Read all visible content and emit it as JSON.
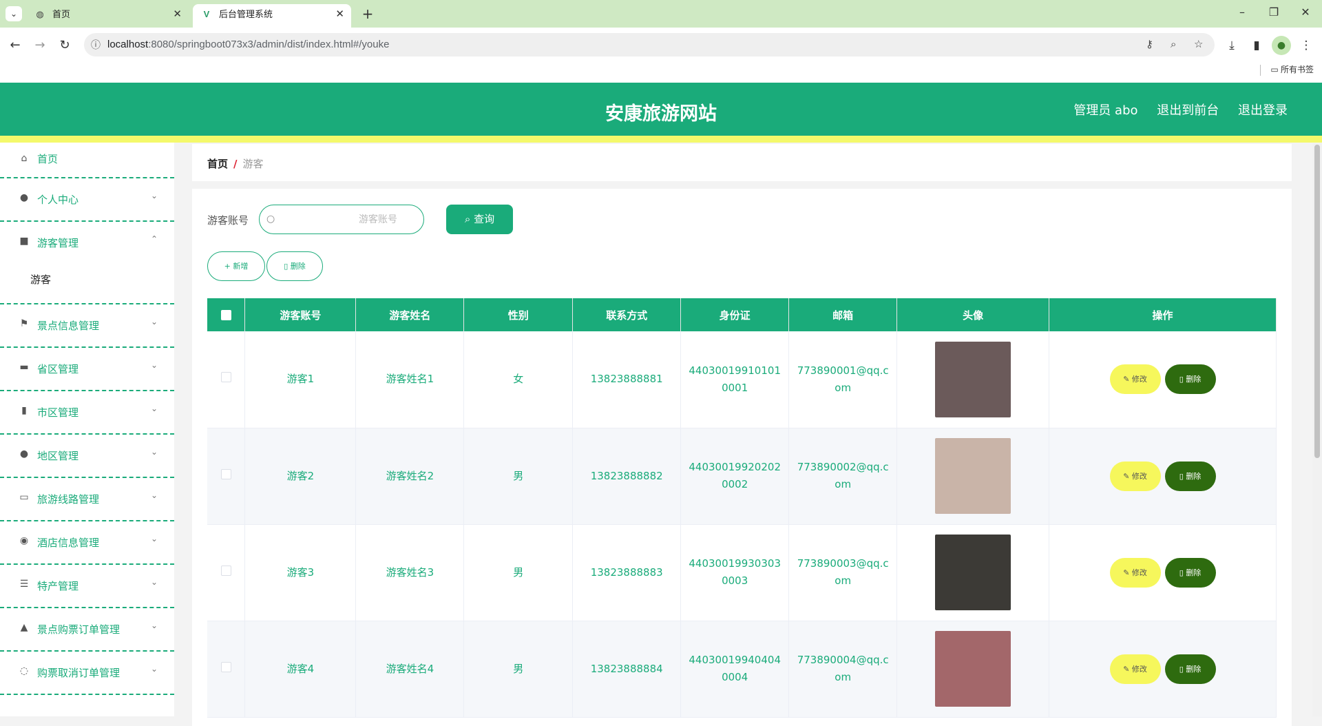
{
  "browser": {
    "tabs": [
      {
        "title": "首页",
        "active": false
      },
      {
        "title": "后台管理系统",
        "active": true
      }
    ],
    "url_host": "localhost",
    "url_path": ":8080/springboot073x3/admin/dist/index.html#/youke",
    "bookmarks_label": "所有书签"
  },
  "header": {
    "title": "安康旅游网站",
    "user": "管理员 abo",
    "to_front": "退出到前台",
    "logout": "退出登录"
  },
  "sidebar": {
    "items": [
      {
        "label": "首页",
        "icon": "home-icon"
      },
      {
        "label": "个人中心",
        "icon": "user-icon"
      },
      {
        "label": "游客管理",
        "icon": "camera-icon",
        "open": true,
        "sub": "游客"
      },
      {
        "label": "景点信息管理",
        "icon": "flag-icon"
      },
      {
        "label": "省区管理",
        "icon": "stamp-icon"
      },
      {
        "label": "市区管理",
        "icon": "bar-chart-icon"
      },
      {
        "label": "地区管理",
        "icon": "user-icon"
      },
      {
        "label": "旅游线路管理",
        "icon": "message-icon"
      },
      {
        "label": "酒店信息管理",
        "icon": "pin-icon"
      },
      {
        "label": "特产管理",
        "icon": "sliders-icon"
      },
      {
        "label": "景点购票订单管理",
        "icon": "stamp-icon"
      },
      {
        "label": "购票取消订单管理",
        "icon": "globe-icon"
      }
    ]
  },
  "breadcrumb": {
    "home": "首页",
    "separator": "/",
    "current": "游客"
  },
  "search": {
    "label": "游客账号",
    "placeholder": "游客账号",
    "button": "查询"
  },
  "actions": {
    "add": "新增",
    "delete": "删除"
  },
  "table": {
    "columns": [
      "游客账号",
      "游客姓名",
      "性别",
      "联系方式",
      "身份证",
      "邮箱",
      "头像",
      "操作"
    ],
    "rows": [
      {
        "account": "游客1",
        "name": "游客姓名1",
        "gender": "女",
        "phone": "13823888881",
        "id_line1": "44030019910101",
        "id_line2": "0001",
        "email_line1": "773890001@qq.c",
        "email_line2": "om",
        "avatar_color": "#6b5a5a"
      },
      {
        "account": "游客2",
        "name": "游客姓名2",
        "gender": "男",
        "phone": "13823888882",
        "id_line1": "44030019920202",
        "id_line2": "0002",
        "email_line1": "773890002@qq.c",
        "email_line2": "om",
        "avatar_color": "#c9b4a8"
      },
      {
        "account": "游客3",
        "name": "游客姓名3",
        "gender": "男",
        "phone": "13823888883",
        "id_line1": "44030019930303",
        "id_line2": "0003",
        "email_line1": "773890003@qq.c",
        "email_line2": "om",
        "avatar_color": "#3c3a36"
      },
      {
        "account": "游客4",
        "name": "游客姓名4",
        "gender": "男",
        "phone": "13823888884",
        "id_line1": "44030019940404",
        "id_line2": "0004",
        "email_line1": "773890004@qq.c",
        "email_line2": "om",
        "avatar_color": "#a3676a"
      }
    ],
    "edit_label": "修改",
    "delete_label": "删除"
  },
  "colors": {
    "primary": "#1aab7a",
    "accent_yellow": "#f4f96b",
    "delete_green": "#2e6b0f"
  }
}
